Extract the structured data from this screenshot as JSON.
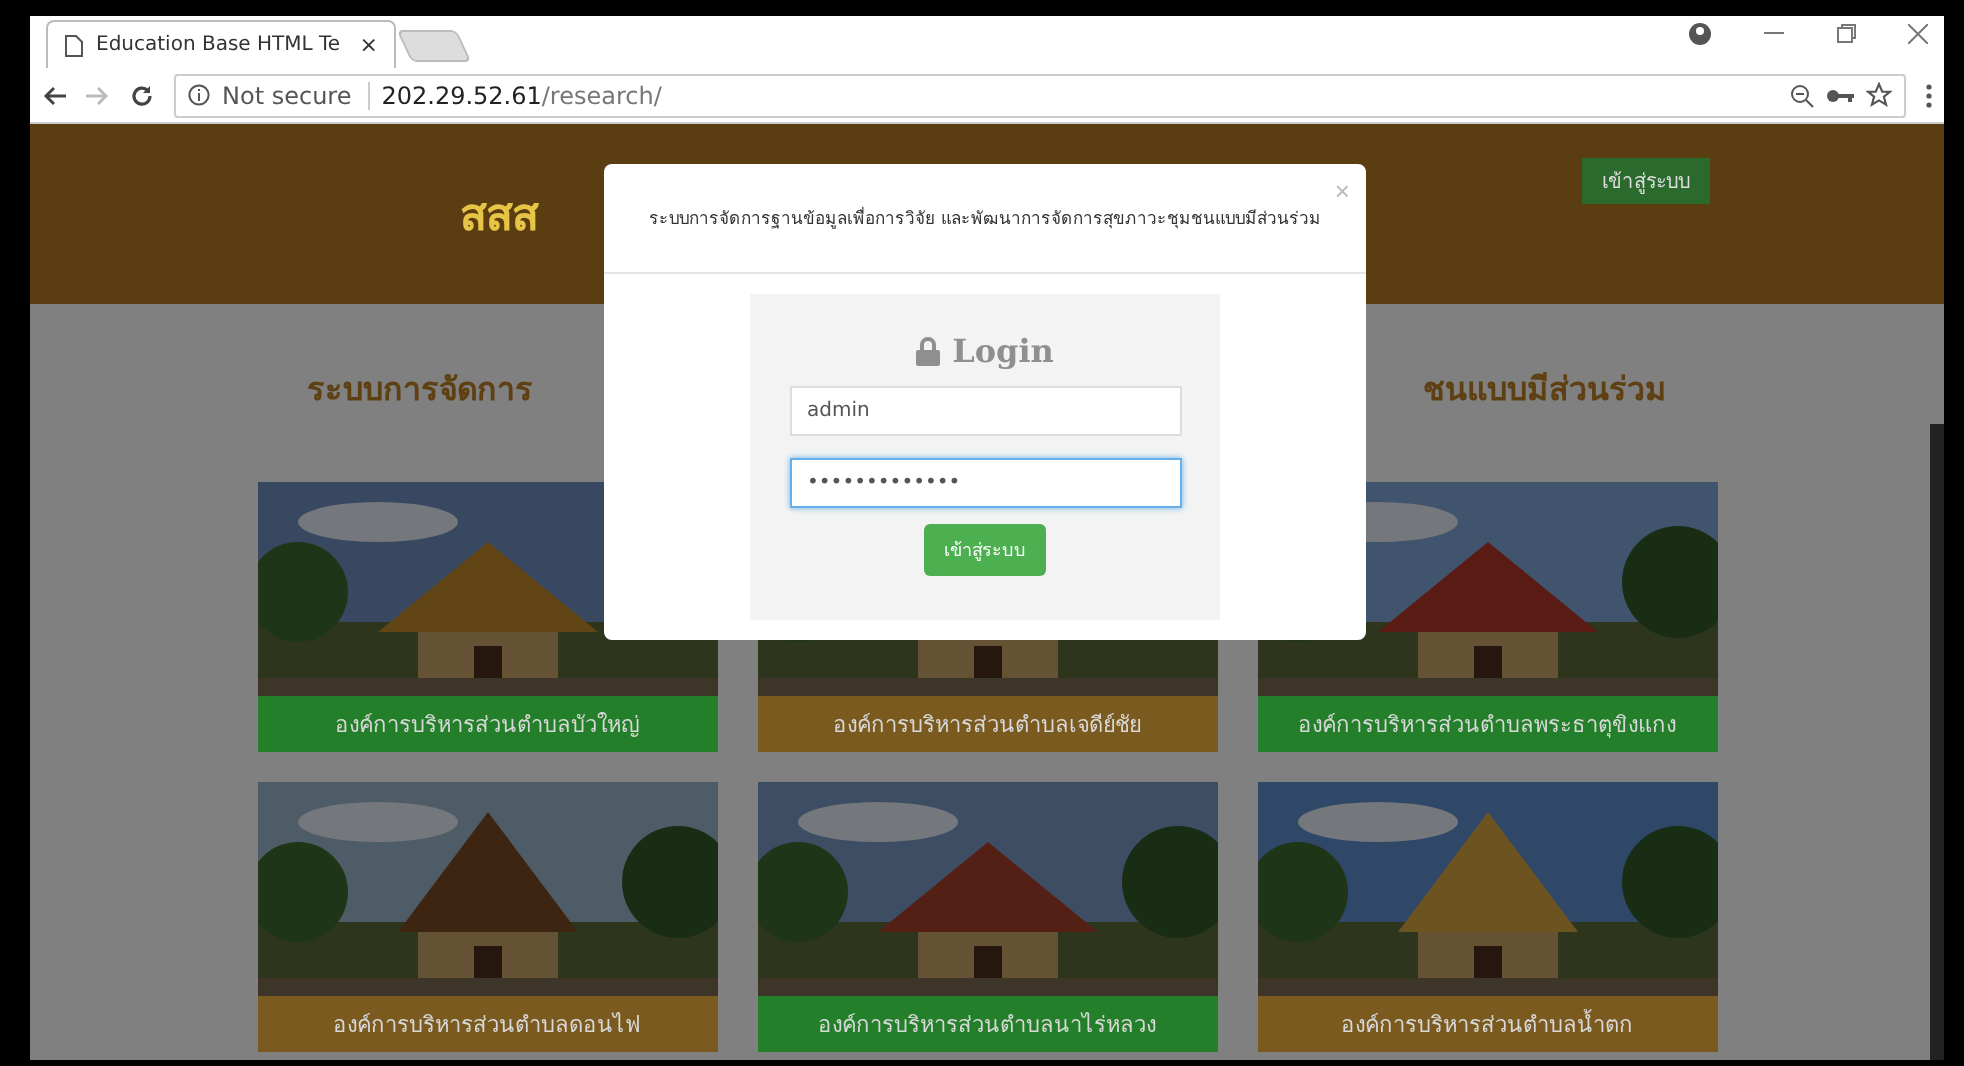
{
  "browser": {
    "tab_title": "Education Base HTML Te",
    "tab_close": "×",
    "security": "Not secure",
    "url_host": "202.29.52.61",
    "url_path": "/research/"
  },
  "header": {
    "logo": "สสส",
    "login_button": "เข้าสู่ระบบ"
  },
  "heading_parts": [
    "ระบบการจัดการ",
    "ชนแบบมีส่วนร่วม"
  ],
  "cards": [
    {
      "caption": "องค์การบริหารส่วนตำบลบัวใหญ่",
      "color": "#237f29",
      "kind": "picture"
    },
    {
      "caption": "องค์การบริหารส่วนตำบลเจดีย์ชัย",
      "color": "#7a5a1e",
      "kind": "picture"
    },
    {
      "caption": "องค์การบริหารส่วนตำบลพระธาตุขิงแกง",
      "color": "#237f29",
      "kind": "picture"
    },
    {
      "caption": "องค์การบริหารส่วนตำบลดอนไฟ",
      "color": "#7a5a1e",
      "kind": "picture"
    },
    {
      "caption": "องค์การบริหารส่วนตำบลนาไร่หลวง",
      "color": "#237f29",
      "kind": "picture"
    },
    {
      "caption": "องค์การบริหารส่วนตำบลน้ำตก",
      "color": "#7a5a1e",
      "kind": "picture"
    }
  ],
  "modal": {
    "title": "ระบบการจัดการฐานข้อมูลเพื่อการวิจัย และพัฒนาการจัดการสุขภาวะชุมชนแบบมีส่วนร่วม",
    "close": "×",
    "login_title": "Login",
    "username": "admin",
    "password": "•••••••••••••",
    "password_focused": true,
    "submit": "เข้าสู่ระบบ"
  }
}
